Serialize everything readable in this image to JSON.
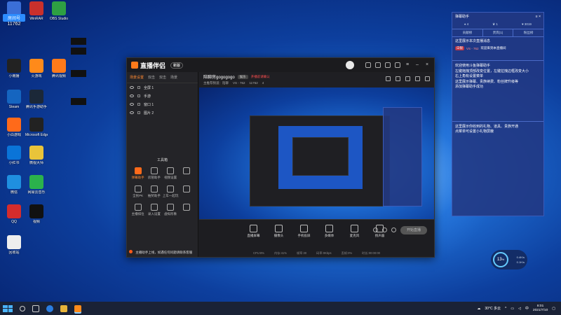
{
  "desktop": {
    "icons": [
      {
        "label": "斗鱼"
      },
      {
        "label": "WinRAR"
      },
      {
        "label": "OBS Studio"
      },
      {
        "label": "小雨播"
      },
      {
        "label": "火游戏"
      },
      {
        "label": "腾讯视频"
      },
      {
        "label": "Steam"
      },
      {
        "label": "腾讯手游助手"
      },
      {
        "label": "小白游戏"
      },
      {
        "label": "Microsoft Edge"
      },
      {
        "label": "小红书"
      },
      {
        "label": "微视大师"
      },
      {
        "label": "微信"
      },
      {
        "label": "网易云音乐"
      },
      {
        "label": "QQ"
      },
      {
        "label": "视频"
      },
      {
        "label": "回收站"
      }
    ],
    "room_badge": "房间号",
    "room_number": "11762"
  },
  "window": {
    "title": "直播伴侣",
    "version": "新版",
    "sidebar": {
      "tabs": [
        "场景设置",
        "双击",
        "双击",
        "场景"
      ],
      "layers": [
        "全屏 1",
        "手游",
        "窗口 1",
        "图片 2"
      ],
      "tools_title": "工具箱",
      "tools": [
        {
          "label": "弹幕助手",
          "active": true
        },
        {
          "label": "房管助手",
          "active": false
        },
        {
          "label": "视频设置",
          "active": false
        },
        {
          "label": "",
          "active": false
        },
        {
          "label": "全民PK",
          "active": false
        },
        {
          "label": "抽奖助手",
          "active": false
        },
        {
          "label": "上车一起玩",
          "active": false
        },
        {
          "label": "",
          "active": false
        },
        {
          "label": "主播排位",
          "active": false
        },
        {
          "label": "录入设置",
          "active": false
        },
        {
          "label": "虚拟形象",
          "active": false
        },
        {
          "label": "",
          "active": false
        }
      ],
      "notice": "主播助手上线，如遇任何问题请联系客服"
    },
    "room": {
      "name": "陪聊房gogogogo",
      "tag": "娱乐",
      "warn": "开播前请确认",
      "meta": [
        "主推荐频道：陪聊",
        "VS - 762",
        "11762"
      ],
      "fans": "4"
    },
    "bottom": {
      "buttons": [
        "直播屏幕",
        "摄像头",
        "手机投屏",
        "多媒体",
        "麦克风",
        "扬声器"
      ],
      "start_label": "开始直播",
      "stats": [
        "CPU:8%",
        "内存:41%",
        "帧率:30",
        "码率:0Kbps",
        "丢帧:0%",
        "时长:00:00:00"
      ]
    }
  },
  "danmu": {
    "title": "弹幕助手",
    "counts": [
      "4",
      "1",
      "3019"
    ],
    "tabs": [
      "贡献榜",
      "贵宾(1)",
      "粉丝榜"
    ],
    "welcome": "这里展示本次直播消息",
    "gift_badge": "白银",
    "gift_user": "VS - 762",
    "gift_text": "欢迎来到本直播间",
    "tips": "欢迎使用斗鱼弹幕助手\n左键拖拽顶部改变位置，左键拉拽边框改变大小\n右上角有设置菜单\n这里展示弹幕、贵族续费、粉丝牌升级等\n添加弹幕助手成功",
    "gift_tips": "这里展示你收到的礼物、道具、贵族开通\n点菜单可设置小礼物屏蔽"
  },
  "float_widget": {
    "value": "13",
    "unit": "%",
    "up": "0.4K/s",
    "down": "0.1K/s"
  },
  "taskbar": {
    "weather": "30°C 多云",
    "time": "8:01",
    "date": "2021/7/10"
  }
}
